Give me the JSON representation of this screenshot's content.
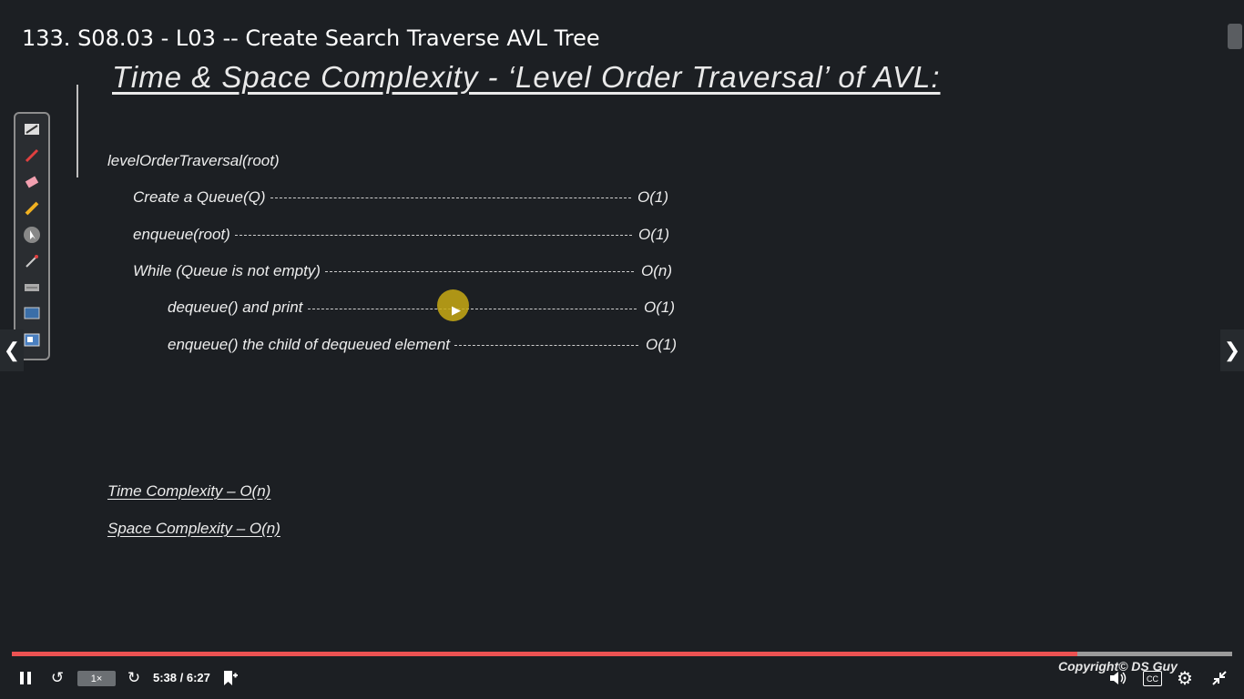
{
  "video": {
    "title": "133. S08.03 - L03 -- Create Search Traverse AVL Tree"
  },
  "slide": {
    "heading": "Time & Space Complexity - ‘Level Order Traversal’ of AVL:",
    "function_name": "levelOrderTraversal(root)",
    "lines": [
      {
        "text": "Create a Queue(Q)",
        "complexity": "O(1)"
      },
      {
        "text": "enqueue(root)",
        "complexity": "O(1)"
      },
      {
        "text": "While (Queue is not empty)",
        "complexity": "O(n)"
      },
      {
        "text": "dequeue() and print",
        "complexity": "O(1)"
      },
      {
        "text": "enqueue() the child of dequeued element",
        "complexity": "O(1)"
      }
    ],
    "time_complexity": "Time Complexity – O(n)",
    "space_complexity": "Space Complexity – O(n)",
    "copyright": "Copyright© DS Guy"
  },
  "annotation_toolbox": {
    "tools": [
      "whiteboard-icon",
      "pen-icon",
      "eraser-icon",
      "highlighter-icon",
      "pointer-icon",
      "brush-icon",
      "keyboard-icon",
      "screen-icon",
      "presentation-icon"
    ]
  },
  "player": {
    "speed": "1×",
    "time": "5:38 / 6:27",
    "progress_percent": 87.3,
    "accent": "#ec5252"
  }
}
